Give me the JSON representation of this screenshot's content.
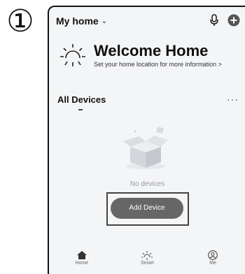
{
  "step": {
    "number": "①"
  },
  "header": {
    "home_title": "My home",
    "chevron_glyph": "⌄"
  },
  "welcome": {
    "title": "Welcome Home",
    "subtitle": "Set your home location for more information >"
  },
  "devices": {
    "title": "All Devices",
    "more_glyph": "···",
    "empty_text": "No devices",
    "add_button_label": "Add Device"
  },
  "tabbar": {
    "tabs": [
      {
        "label": "Home",
        "icon": "home-icon"
      },
      {
        "label": "Smart",
        "icon": "sun-icon"
      },
      {
        "label": "Me",
        "icon": "user-icon"
      }
    ]
  },
  "colors": {
    "add_button": "#666666",
    "background": "#f4f5f7"
  }
}
